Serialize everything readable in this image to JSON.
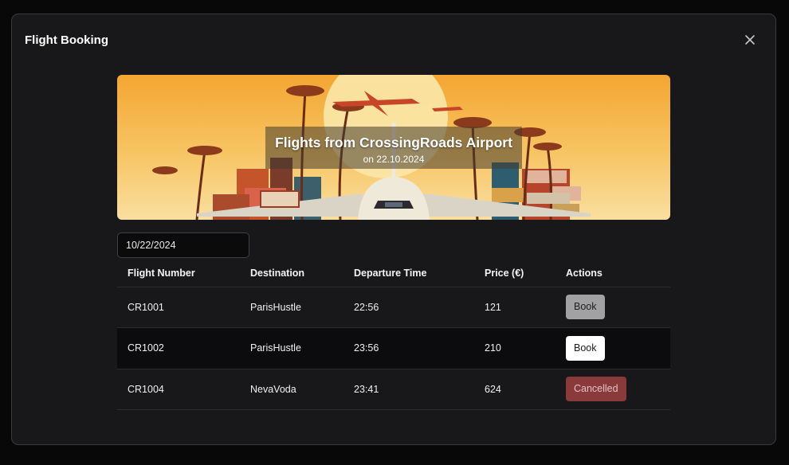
{
  "modal": {
    "title": "Flight Booking"
  },
  "banner": {
    "title": "Flights from CrossingRoads Airport",
    "subtitle": "on 22.10.2024"
  },
  "date_input": {
    "value": "10/22/2024"
  },
  "table": {
    "headers": [
      "Flight Number",
      "Destination",
      "Departure Time",
      "Price (€)",
      "Actions"
    ],
    "rows": [
      {
        "flight": "CR1001",
        "destination": "ParisHustle",
        "time": "22:56",
        "price": "121",
        "action": "Book",
        "state": "disabled"
      },
      {
        "flight": "CR1002",
        "destination": "ParisHustle",
        "time": "23:56",
        "price": "210",
        "action": "Book",
        "state": "active"
      },
      {
        "flight": "CR1004",
        "destination": "NevaVoda",
        "time": "23:41",
        "price": "624",
        "action": "Cancelled",
        "state": "cancelled"
      }
    ]
  },
  "colors": {
    "modal_bg": "#18181a",
    "book_disabled": "#a1a1a3",
    "book_active": "#ffffff",
    "cancelled": "#8b3a3c"
  }
}
